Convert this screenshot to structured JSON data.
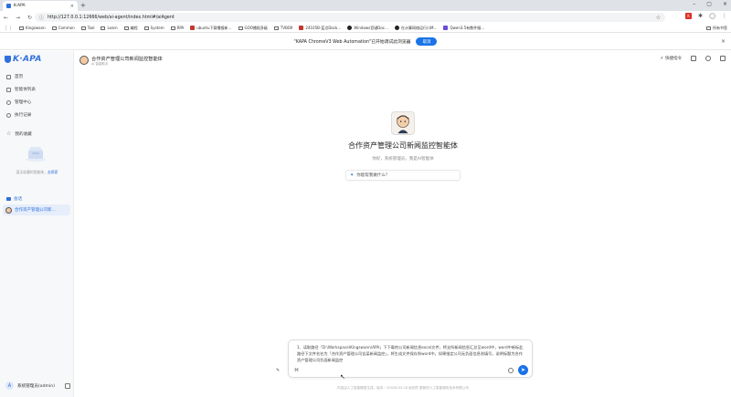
{
  "browser": {
    "tab_title": "K-APA",
    "url": "http://127.0.0.1:12666/web/ai-agent/index.html#/aiAgent",
    "bookmarks": [
      "Kingswann",
      "Common",
      "Tool",
      "Learn",
      "编程",
      "System",
      "RPA",
      "ubuntu下载播报新…",
      "GOO播报多级",
      "TVBOX",
      "24105B-蓝点Dock…",
      "Windows官键Doc…",
      "在计算网络运行口M…",
      "Qwen3.5有数件服…"
    ],
    "bookmarks_right": "所有书签",
    "infobar_text": "\"KAPA ChromeV3 Web Automation\"已开始调试此浏览器",
    "infobar_cancel": "取消"
  },
  "sidebar": {
    "logo": "K·APA",
    "menu": [
      {
        "label": "首页",
        "icon": "home-icon"
      },
      {
        "label": "智能体列表",
        "icon": "grid-icon"
      },
      {
        "label": "管理中心",
        "icon": "manage-icon"
      },
      {
        "label": "执行记录",
        "icon": "clock-icon"
      },
      {
        "label": "我的收藏",
        "icon": "star-icon"
      }
    ],
    "empty_text": "暂无收藏的智能体，",
    "empty_link": "去探索",
    "section_label": "会话",
    "agent_item": "合作资产管理公司新…",
    "user_name": "系统管理员(admin)",
    "user_initial": "A"
  },
  "header": {
    "title": "合作资产管理公司新闻监控智能体",
    "subtitle": "AI 智能助手",
    "quick_command": "快捷指令"
  },
  "welcome": {
    "title": "合作资产管理公司新闻监控智能体",
    "greeting": "你好，系统管理员，我是AI智能体",
    "suggestion": "你能帮我做什么？"
  },
  "input": {
    "text": "1、读取路径「D:\\Workspace\\Kingswann\\APA」下下载的公司新闻信息excel文件，将支所新闻信息汇总至word中，word中新标此路径下文件名名为「合作资产管理公司含某新闻监控」，将生成文件保存到word中。如果指定公司无负面信息则填写，说明标题为合作资产管理公司负面新闻监控"
  },
  "footer": "内容由人工智能模型生成，版本：V2026.03.18 经初的 更新的人工智能服务技术有限公司"
}
